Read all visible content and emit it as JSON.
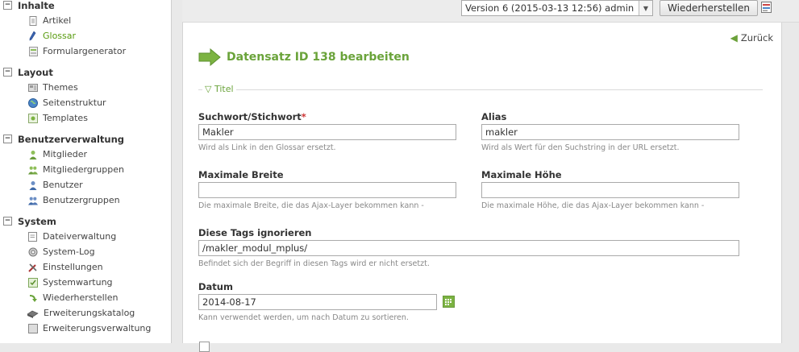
{
  "sidebar": {
    "groups": [
      {
        "title": "Inhalte",
        "toggle": "−",
        "items": [
          {
            "label": "Artikel",
            "icon": "document-icon"
          },
          {
            "label": "Glossar",
            "icon": "pen-icon",
            "active": true
          },
          {
            "label": "Formulargenerator",
            "icon": "form-icon"
          }
        ]
      },
      {
        "title": "Layout",
        "toggle": "−",
        "items": [
          {
            "label": "Themes",
            "icon": "themes-icon"
          },
          {
            "label": "Seitenstruktur",
            "icon": "globe-icon"
          },
          {
            "label": "Templates",
            "icon": "templates-icon"
          }
        ]
      },
      {
        "title": "Benutzerverwaltung",
        "toggle": "−",
        "items": [
          {
            "label": "Mitglieder",
            "icon": "member-icon"
          },
          {
            "label": "Mitgliedergruppen",
            "icon": "member-group-icon"
          },
          {
            "label": "Benutzer",
            "icon": "user-icon"
          },
          {
            "label": "Benutzergruppen",
            "icon": "user-group-icon"
          }
        ]
      },
      {
        "title": "System",
        "toggle": "−",
        "items": [
          {
            "label": "Dateiverwaltung",
            "icon": "folder-icon"
          },
          {
            "label": "System-Log",
            "icon": "log-icon"
          },
          {
            "label": "Einstellungen",
            "icon": "settings-icon"
          },
          {
            "label": "Systemwartung",
            "icon": "maintenance-icon"
          },
          {
            "label": "Wiederherstellen",
            "icon": "restore-icon"
          },
          {
            "label": "Erweiterungskatalog",
            "icon": "catalog-icon"
          },
          {
            "label": "Erweiterungsverwaltung",
            "icon": "extension-icon"
          }
        ]
      }
    ]
  },
  "toolbar": {
    "version_value": "Version 6 (2015-03-13 12:56) admin",
    "restore_label": "Wiederherstellen"
  },
  "main": {
    "back_label": "Zurück",
    "title": "Datensatz ID 138 bearbeiten",
    "legend": "Titel",
    "legend_marker": "▽",
    "fields": {
      "keyword": {
        "label": "Suchwort/Stichwort",
        "required_mark": "*",
        "value": "Makler",
        "help": "Wird als Link in den Glossar ersetzt."
      },
      "alias": {
        "label": "Alias",
        "value": "makler",
        "help": "Wird als Wert für den Suchstring in der URL ersetzt."
      },
      "max_width": {
        "label": "Maximale Breite",
        "value": "",
        "help": "Die maximale Breite, die das Ajax-Layer bekommen kann -"
      },
      "max_height": {
        "label": "Maximale Höhe",
        "value": "",
        "help": "Die maximale Höhe, die das Ajax-Layer bekommen kann -"
      },
      "ignore_tags": {
        "label": "Diese Tags ignorieren",
        "value": "/makler_modul_mplus/",
        "help": "Befindet sich der Begriff in diesen Tags wird er nicht ersetzt."
      },
      "date": {
        "label": "Datum",
        "value": "2014-08-17",
        "help": "Kann verwendet werden, um nach Datum zu sortieren."
      }
    }
  },
  "colors": {
    "accent": "#6aa33a",
    "required": "#cc3333"
  }
}
